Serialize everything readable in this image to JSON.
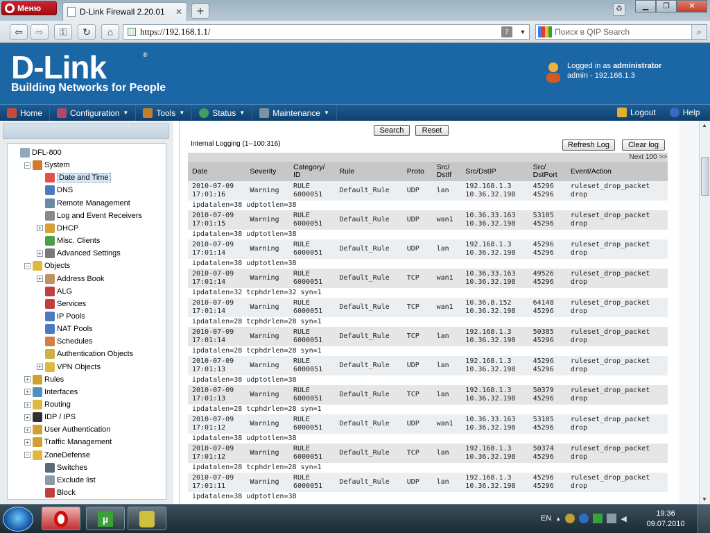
{
  "browser": {
    "menu_label": "Меню",
    "tab_title": "D-Link Firewall 2.20.01",
    "address": "https://192.168.1.1/",
    "search_placeholder": "Поиск в QIP Search"
  },
  "header": {
    "logo": "D-Link",
    "tagline": "Building Networks for People",
    "logged_prefix": "Logged in as",
    "logged_user": "administrator",
    "logged_detail": "admin - 192.168.1.3"
  },
  "menu": {
    "home": "Home",
    "configuration": "Configuration",
    "tools": "Tools",
    "status": "Status",
    "maintenance": "Maintenance",
    "logout": "Logout",
    "help": "Help"
  },
  "tree": [
    {
      "label": "DFL-800",
      "level": 0,
      "toggle": "",
      "icon": "#8fa8c0"
    },
    {
      "label": "System",
      "level": 1,
      "toggle": "-",
      "icon": "#d07a2a"
    },
    {
      "label": "Date and Time",
      "level": 2,
      "toggle": "",
      "icon": "#e05050",
      "selected": true
    },
    {
      "label": "DNS",
      "level": 2,
      "toggle": "",
      "icon": "#4a7ac0"
    },
    {
      "label": "Remote Management",
      "level": 2,
      "toggle": "",
      "icon": "#6a8aa0"
    },
    {
      "label": "Log and Event Receivers",
      "level": 2,
      "toggle": "",
      "icon": "#8a8a8a"
    },
    {
      "label": "DHCP",
      "level": 2,
      "toggle": "+",
      "icon": "#d8a030"
    },
    {
      "label": "Misc. Clients",
      "level": 2,
      "toggle": "",
      "icon": "#4aa04a"
    },
    {
      "label": "Advanced Settings",
      "level": 2,
      "toggle": "+",
      "icon": "#7a7a7a"
    },
    {
      "label": "Objects",
      "level": 1,
      "toggle": "-",
      "icon": "#e0b840"
    },
    {
      "label": "Address Book",
      "level": 2,
      "toggle": "+",
      "icon": "#c09060"
    },
    {
      "label": "ALG",
      "level": 2,
      "toggle": "",
      "icon": "#c04040"
    },
    {
      "label": "Services",
      "level": 2,
      "toggle": "",
      "icon": "#c04040"
    },
    {
      "label": "IP Pools",
      "level": 2,
      "toggle": "",
      "icon": "#4a7ac0"
    },
    {
      "label": "NAT Pools",
      "level": 2,
      "toggle": "",
      "icon": "#4a7ac0"
    },
    {
      "label": "Schedules",
      "level": 2,
      "toggle": "",
      "icon": "#d08040"
    },
    {
      "label": "Authentication Objects",
      "level": 2,
      "toggle": "",
      "icon": "#d0b040"
    },
    {
      "label": "VPN Objects",
      "level": 2,
      "toggle": "+",
      "icon": "#e0b840"
    },
    {
      "label": "Rules",
      "level": 1,
      "toggle": "+",
      "icon": "#d0a030"
    },
    {
      "label": "Interfaces",
      "level": 1,
      "toggle": "+",
      "icon": "#5090c0"
    },
    {
      "label": "Routing",
      "level": 1,
      "toggle": "+",
      "icon": "#e0b840"
    },
    {
      "label": "IDP / IPS",
      "level": 1,
      "toggle": "+",
      "icon": "#303030"
    },
    {
      "label": "User Authentication",
      "level": 1,
      "toggle": "+",
      "icon": "#d0a030"
    },
    {
      "label": "Traffic Management",
      "level": 1,
      "toggle": "+",
      "icon": "#d0a030"
    },
    {
      "label": "ZoneDefense",
      "level": 1,
      "toggle": "-",
      "icon": "#e0b840"
    },
    {
      "label": "Switches",
      "level": 2,
      "toggle": "",
      "icon": "#5a6a7a"
    },
    {
      "label": "Exclude list",
      "level": 2,
      "toggle": "",
      "icon": "#8a9aa6"
    },
    {
      "label": "Block",
      "level": 2,
      "toggle": "",
      "icon": "#c04040"
    }
  ],
  "log": {
    "search_label": "Search",
    "reset_label": "Reset",
    "title": "Internal Logging (1--100:316)",
    "refresh_label": "Refresh Log",
    "clear_label": "Clear log",
    "next_label": "Next 100 >>",
    "columns": [
      "Date",
      "Severity",
      "Category/\nID",
      "Rule",
      "Proto",
      "Src/\nDstIf",
      "Src/DstIP",
      "Src/\nDstPort",
      "Event/Action"
    ],
    "rows": [
      {
        "date": "2010-07-09\n17:01:16",
        "sev": "Warning",
        "cat": "RULE\n6000051",
        "rule": "Default_Rule",
        "proto": "UDP",
        "iface": "lan",
        "ip": "192.168.1.3\n10.36.32.198",
        "port": "45296\n45296",
        "event": "ruleset_drop_packet\ndrop",
        "extra": "ipdatalen=38 udptotlen=38"
      },
      {
        "date": "2010-07-09\n17:01:15",
        "sev": "Warning",
        "cat": "RULE\n6000051",
        "rule": "Default_Rule",
        "proto": "UDP",
        "iface": "wan1",
        "ip": "10.36.33.163\n10.36.32.198",
        "port": "53105\n45296",
        "event": "ruleset_drop_packet\ndrop",
        "extra": "ipdatalen=38 udptotlen=38"
      },
      {
        "date": "2010-07-09\n17:01:14",
        "sev": "Warning",
        "cat": "RULE\n6000051",
        "rule": "Default_Rule",
        "proto": "UDP",
        "iface": "lan",
        "ip": "192.168.1.3\n10.36.32.198",
        "port": "45296\n45296",
        "event": "ruleset_drop_packet\ndrop",
        "extra": "ipdatalen=38 udptotlen=38"
      },
      {
        "date": "2010-07-09\n17:01:14",
        "sev": "Warning",
        "cat": "RULE\n6000051",
        "rule": "Default_Rule",
        "proto": "TCP",
        "iface": "wan1",
        "ip": "10.36.33.163\n10.36.32.198",
        "port": "49526\n45296",
        "event": "ruleset_drop_packet\ndrop",
        "extra": "ipdatalen=32 tcphdrlen=32 syn=1"
      },
      {
        "date": "2010-07-09\n17:01:14",
        "sev": "Warning",
        "cat": "RULE\n6000051",
        "rule": "Default_Rule",
        "proto": "TCP",
        "iface": "wan1",
        "ip": "10.36.8.152\n10.36.32.198",
        "port": "64148\n45296",
        "event": "ruleset_drop_packet\ndrop",
        "extra": "ipdatalen=28 tcphdrlen=28 syn=1"
      },
      {
        "date": "2010-07-09\n17:01:14",
        "sev": "Warning",
        "cat": "RULE\n6000051",
        "rule": "Default_Rule",
        "proto": "TCP",
        "iface": "lan",
        "ip": "192.168.1.3\n10.36.32.198",
        "port": "50385\n45296",
        "event": "ruleset_drop_packet\ndrop",
        "extra": "ipdatalen=28 tcphdrlen=28 syn=1"
      },
      {
        "date": "2010-07-09\n17:01:13",
        "sev": "Warning",
        "cat": "RULE\n6000051",
        "rule": "Default_Rule",
        "proto": "UDP",
        "iface": "lan",
        "ip": "192.168.1.3\n10.36.32.198",
        "port": "45296\n45296",
        "event": "ruleset_drop_packet\ndrop",
        "extra": "ipdatalen=38 udptotlen=38"
      },
      {
        "date": "2010-07-09\n17:01:13",
        "sev": "Warning",
        "cat": "RULE\n6000051",
        "rule": "Default_Rule",
        "proto": "TCP",
        "iface": "lan",
        "ip": "192.168.1.3\n10.36.32.198",
        "port": "50379\n45296",
        "event": "ruleset_drop_packet\ndrop",
        "extra": "ipdatalen=28 tcphdrlen=28 syn=1"
      },
      {
        "date": "2010-07-09\n17:01:12",
        "sev": "Warning",
        "cat": "RULE\n6000051",
        "rule": "Default_Rule",
        "proto": "UDP",
        "iface": "wan1",
        "ip": "10.36.33.163\n10.36.32.198",
        "port": "53105\n45296",
        "event": "ruleset_drop_packet\ndrop",
        "extra": "ipdatalen=38 udptotlen=38"
      },
      {
        "date": "2010-07-09\n17:01:12",
        "sev": "Warning",
        "cat": "RULE\n6000051",
        "rule": "Default_Rule",
        "proto": "TCP",
        "iface": "lan",
        "ip": "192.168.1.3\n10.36.32.198",
        "port": "50374\n45296",
        "event": "ruleset_drop_packet\ndrop",
        "extra": "ipdatalen=28 tcphdrlen=28 syn=1"
      },
      {
        "date": "2010-07-09\n17:01:11",
        "sev": "Warning",
        "cat": "RULE\n6000051",
        "rule": "Default_Rule",
        "proto": "UDP",
        "iface": "lan",
        "ip": "192.168.1.3\n10.36.32.198",
        "port": "45296\n45296",
        "event": "ruleset_drop_packet\ndrop",
        "extra": "ipdatalen=38 udptotlen=38"
      }
    ]
  },
  "taskbar": {
    "lang": "EN",
    "time": "19:36",
    "date": "09.07.2010"
  },
  "colors": {
    "dlink_blue": "#1b67a5",
    "menu_bar": "#15507f",
    "table_header": "#c7c7c7"
  }
}
